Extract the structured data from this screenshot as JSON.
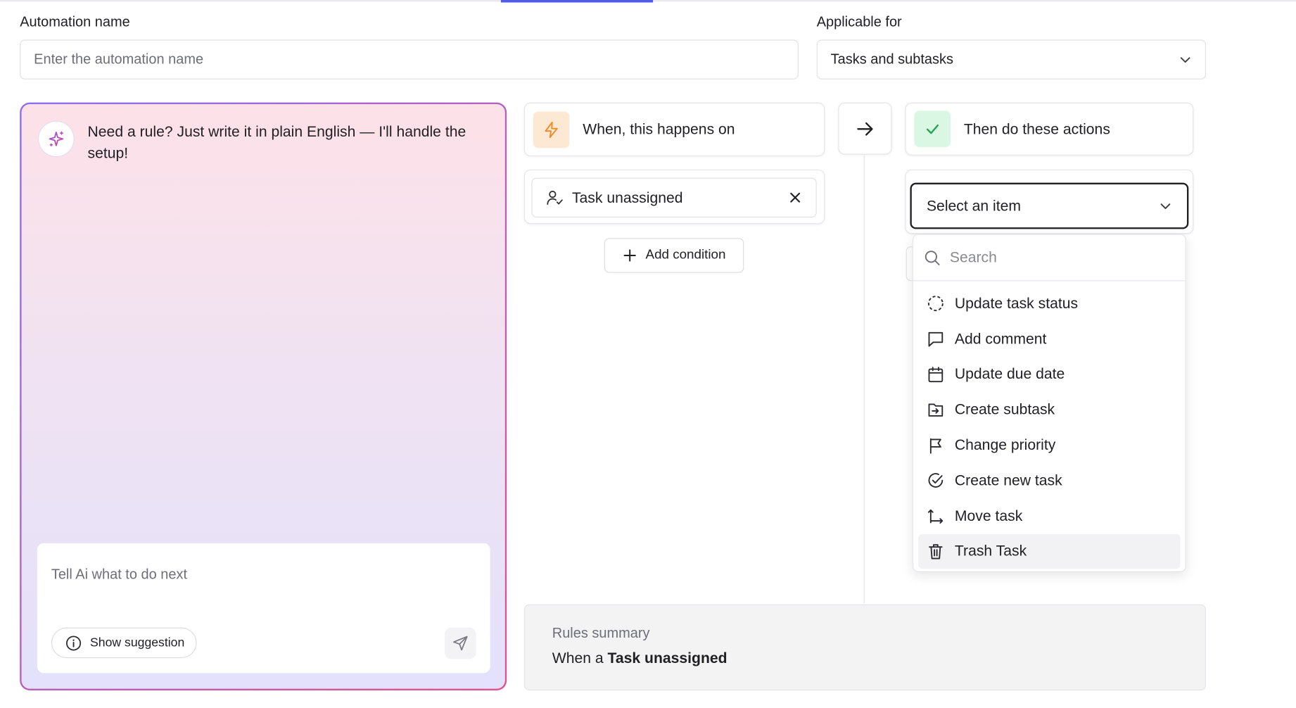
{
  "form": {
    "name_label": "Automation name",
    "name_placeholder": "Enter the automation name",
    "applicable_label": "Applicable for",
    "applicable_value": "Tasks and subtasks"
  },
  "ai": {
    "message": "Need a rule? Just write it in plain English — I'll handle the setup!",
    "input_placeholder": "Tell Ai what to do next",
    "suggestion_button": "Show suggestion"
  },
  "trigger": {
    "header": "When, this happens on",
    "selected": "Task unassigned",
    "add_condition": "Add condition"
  },
  "actions": {
    "header": "Then do these actions",
    "select_placeholder": "Select an item",
    "search_placeholder": "Search",
    "items": [
      {
        "label": "Update task status",
        "icon": "dashed-circle-icon"
      },
      {
        "label": "Add comment",
        "icon": "comment-icon"
      },
      {
        "label": "Update due date",
        "icon": "calendar-icon"
      },
      {
        "label": "Create subtask",
        "icon": "subtask-icon"
      },
      {
        "label": "Change priority",
        "icon": "flag-icon"
      },
      {
        "label": "Create new task",
        "icon": "check-circle-icon"
      },
      {
        "label": "Move task",
        "icon": "move-icon"
      },
      {
        "label": "Trash Task",
        "icon": "trash-icon"
      }
    ],
    "hovered_index": 7
  },
  "summary": {
    "title": "Rules summary",
    "prefix": "When a",
    "bold": "Task unassigned"
  },
  "colors": {
    "accent": "#4f5bea",
    "trigger_tile": "#fde8d4",
    "trigger_icon": "#f08a24",
    "action_tile": "#d9f7e3",
    "action_icon": "#22a355"
  }
}
